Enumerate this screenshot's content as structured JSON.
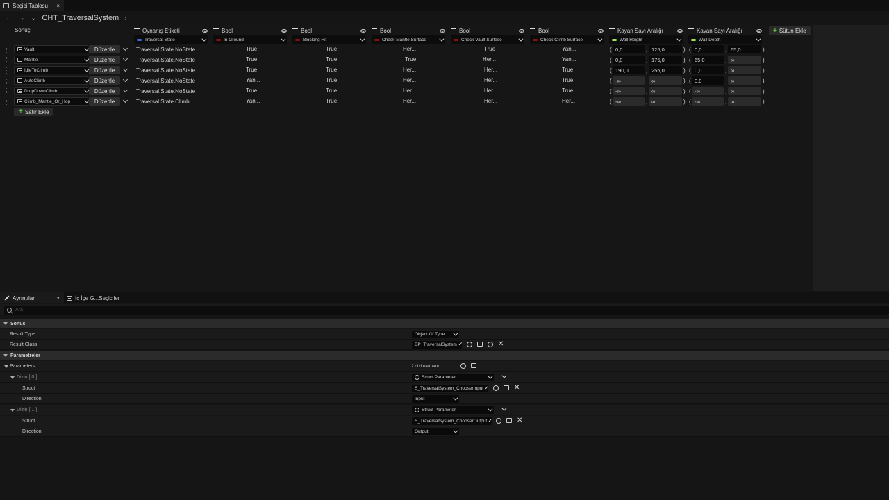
{
  "tab": {
    "title": "Seçici Tablosu",
    "close": "×"
  },
  "nav": {
    "title": "CHT_TraversalSystem",
    "back": "←",
    "forward": "→",
    "history": "⌄",
    "chevron": "›"
  },
  "grid": {
    "result_header": "Sonuç",
    "add_column": "Sütun Ekle",
    "add_row": "Satır Ekle",
    "edit_label": "Düzenle",
    "columns": [
      {
        "type": "Oynanış Etiketi",
        "name": "Traversal State",
        "color": "#3a6fd8"
      },
      {
        "type": "Bool",
        "name": "In Ground",
        "color": "#8a1010"
      },
      {
        "type": "Bool",
        "name": "Blocking Hit",
        "color": "#8a1010"
      },
      {
        "type": "Bool",
        "name": "Check Mantle Surface",
        "color": "#8a1010"
      },
      {
        "type": "Bool",
        "name": "Check Vault Surface",
        "color": "#8a1010"
      },
      {
        "type": "Bool",
        "name": "Check Climb Surface",
        "color": "#8a1010"
      },
      {
        "type": "Kayan Sayı Aralığı",
        "name": "Wall Height",
        "color": "#9fe84a"
      },
      {
        "type": "Kayan Sayı Aralığı",
        "name": "Wall Depth",
        "color": "#9fe84a"
      }
    ],
    "rows": [
      {
        "name": "Vault",
        "tag": "Traversal.State.NoState",
        "b": [
          "True",
          "True",
          "Her...",
          "True",
          "Yan..."
        ],
        "wh": [
          "0,0",
          "125,0"
        ],
        "wd": [
          "0,0",
          "65,0"
        ]
      },
      {
        "name": "Mantle",
        "tag": "Traversal.State.NoState",
        "b": [
          "True",
          "True",
          "True",
          "Her...",
          "Yan..."
        ],
        "wh": [
          "0,0",
          "175,0"
        ],
        "wd": [
          "65,0",
          "∞"
        ]
      },
      {
        "name": "IdleToClimb",
        "tag": "Traversal.State.NoState",
        "b": [
          "True",
          "True",
          "Her...",
          "Her...",
          "True"
        ],
        "wh": [
          "190,0",
          "255,0"
        ],
        "wd": [
          "0,0",
          "∞"
        ]
      },
      {
        "name": "AutoClimb",
        "tag": "Traversal.State.NoState",
        "b": [
          "Yan...",
          "True",
          "Her...",
          "Her...",
          "True"
        ],
        "wh": [
          "-∞",
          "∞"
        ],
        "wd": [
          "0,0",
          "∞"
        ]
      },
      {
        "name": "DropDownClimb",
        "tag": "Traversal.State.NoState",
        "b": [
          "True",
          "True",
          "Her...",
          "Her...",
          "True"
        ],
        "wh": [
          "-∞",
          "∞"
        ],
        "wd": [
          "-∞",
          "∞"
        ]
      },
      {
        "name": "Climb_Mantle_Or_Hop",
        "tag": "Traversal.State.Climb",
        "b": [
          "Yan...",
          "True",
          "Her...",
          "Her...",
          "Her..."
        ],
        "wh": [
          "-∞",
          "∞"
        ],
        "wd": [
          "-∞",
          "∞"
        ]
      }
    ]
  },
  "details": {
    "tab1": "Ayrıntılar",
    "tab1_close": "×",
    "tab2": "İç İçe G...Seçiciler",
    "search_placeholder": "Ara",
    "sec_result": "Sonuç",
    "result_type_label": "Result Type",
    "result_type_value": "Object Of Type",
    "result_class_label": "Result Class",
    "result_class_value": "BP_TraversalSystem",
    "sec_params": "Parametreler",
    "params_label": "Parameters",
    "params_count": "2 dizi elemanı",
    "arr0": "Dizin [ 0 ]",
    "arr0_value": "Struct Parameter",
    "struct_label": "Struct",
    "struct0_value": "S_TraversalSystem_ChooserInput",
    "direction_label": "Direction",
    "direction0_value": "Input",
    "arr1": "Dizin [ 1 ]",
    "arr1_value": "Struct Parameter",
    "struct1_value": "S_TraversalSystem_ChooserOutput",
    "direction1_value": "Output"
  }
}
